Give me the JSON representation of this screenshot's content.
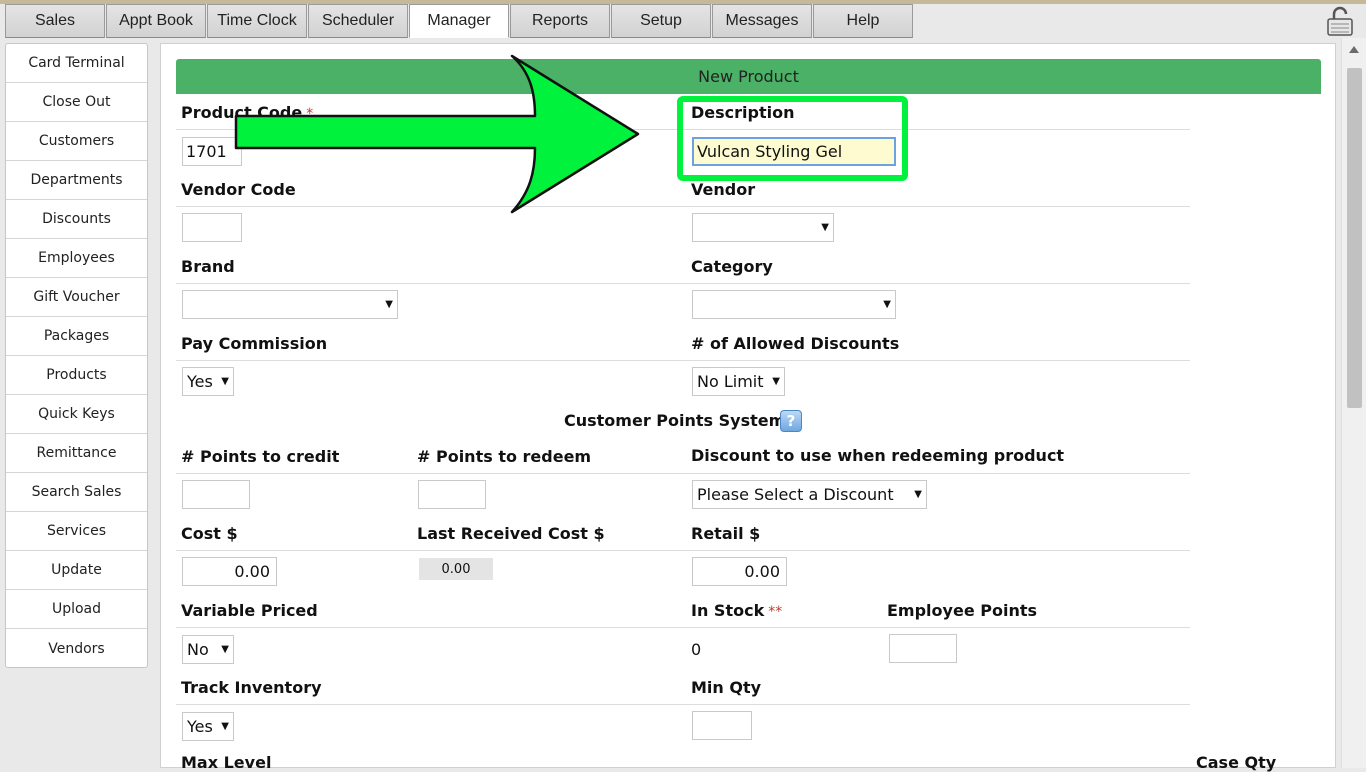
{
  "tabs": [
    {
      "label": "Sales",
      "active": false
    },
    {
      "label": "Appt Book",
      "active": false
    },
    {
      "label": "Time Clock",
      "active": false
    },
    {
      "label": "Scheduler",
      "active": false
    },
    {
      "label": "Manager",
      "active": true
    },
    {
      "label": "Reports",
      "active": false
    },
    {
      "label": "Setup",
      "active": false
    },
    {
      "label": "Messages",
      "active": false
    },
    {
      "label": "Help",
      "active": false
    }
  ],
  "sidebar": {
    "items": [
      "Card Terminal",
      "Close Out",
      "Customers",
      "Departments",
      "Discounts",
      "Employees",
      "Gift Voucher",
      "Packages",
      "Products",
      "Quick Keys",
      "Remittance",
      "Search Sales",
      "Services",
      "Update",
      "Upload",
      "Vendors"
    ]
  },
  "form": {
    "title": "New Product",
    "required_mark": "*",
    "double_required_mark": "**",
    "product_code": {
      "label": "Product Code",
      "value": "1701"
    },
    "description": {
      "label": "Description",
      "value": "Vulcan Styling Gel"
    },
    "vendor_code": {
      "label": "Vendor Code",
      "value": ""
    },
    "vendor": {
      "label": "Vendor",
      "value": ""
    },
    "brand": {
      "label": "Brand",
      "value": ""
    },
    "category": {
      "label": "Category",
      "value": ""
    },
    "pay_commission": {
      "label": "Pay Commission",
      "value": "Yes"
    },
    "allowed_discounts": {
      "label": "# of Allowed Discounts",
      "value": "No Limit"
    },
    "points_section": {
      "title": "Customer Points System",
      "help_glyph": "?"
    },
    "points_credit": {
      "label": "# Points to credit",
      "value": ""
    },
    "points_redeem": {
      "label": "# Points to redeem",
      "value": ""
    },
    "redeem_discount": {
      "label": "Discount to use when redeeming product",
      "value": "Please Select a Discount"
    },
    "cost": {
      "label": "Cost $",
      "value": "0.00"
    },
    "last_received_cost": {
      "label": "Last Received Cost $",
      "value": "0.00"
    },
    "retail": {
      "label": "Retail $",
      "value": "0.00"
    },
    "variable_priced": {
      "label": "Variable Priced",
      "value": "No"
    },
    "in_stock": {
      "label": "In Stock",
      "value": "0"
    },
    "employee_points": {
      "label": "Employee Points",
      "value": ""
    },
    "track_inventory": {
      "label": "Track Inventory",
      "value": "Yes"
    },
    "min_qty": {
      "label": "Min Qty",
      "value": ""
    },
    "max_level": {
      "label": "Max Level"
    },
    "case_qty": {
      "label": "Case Qty"
    }
  },
  "colors": {
    "header_green": "#4bb166",
    "annotation_green": "#00f23c",
    "highlight_input": "#fdfbcf"
  }
}
